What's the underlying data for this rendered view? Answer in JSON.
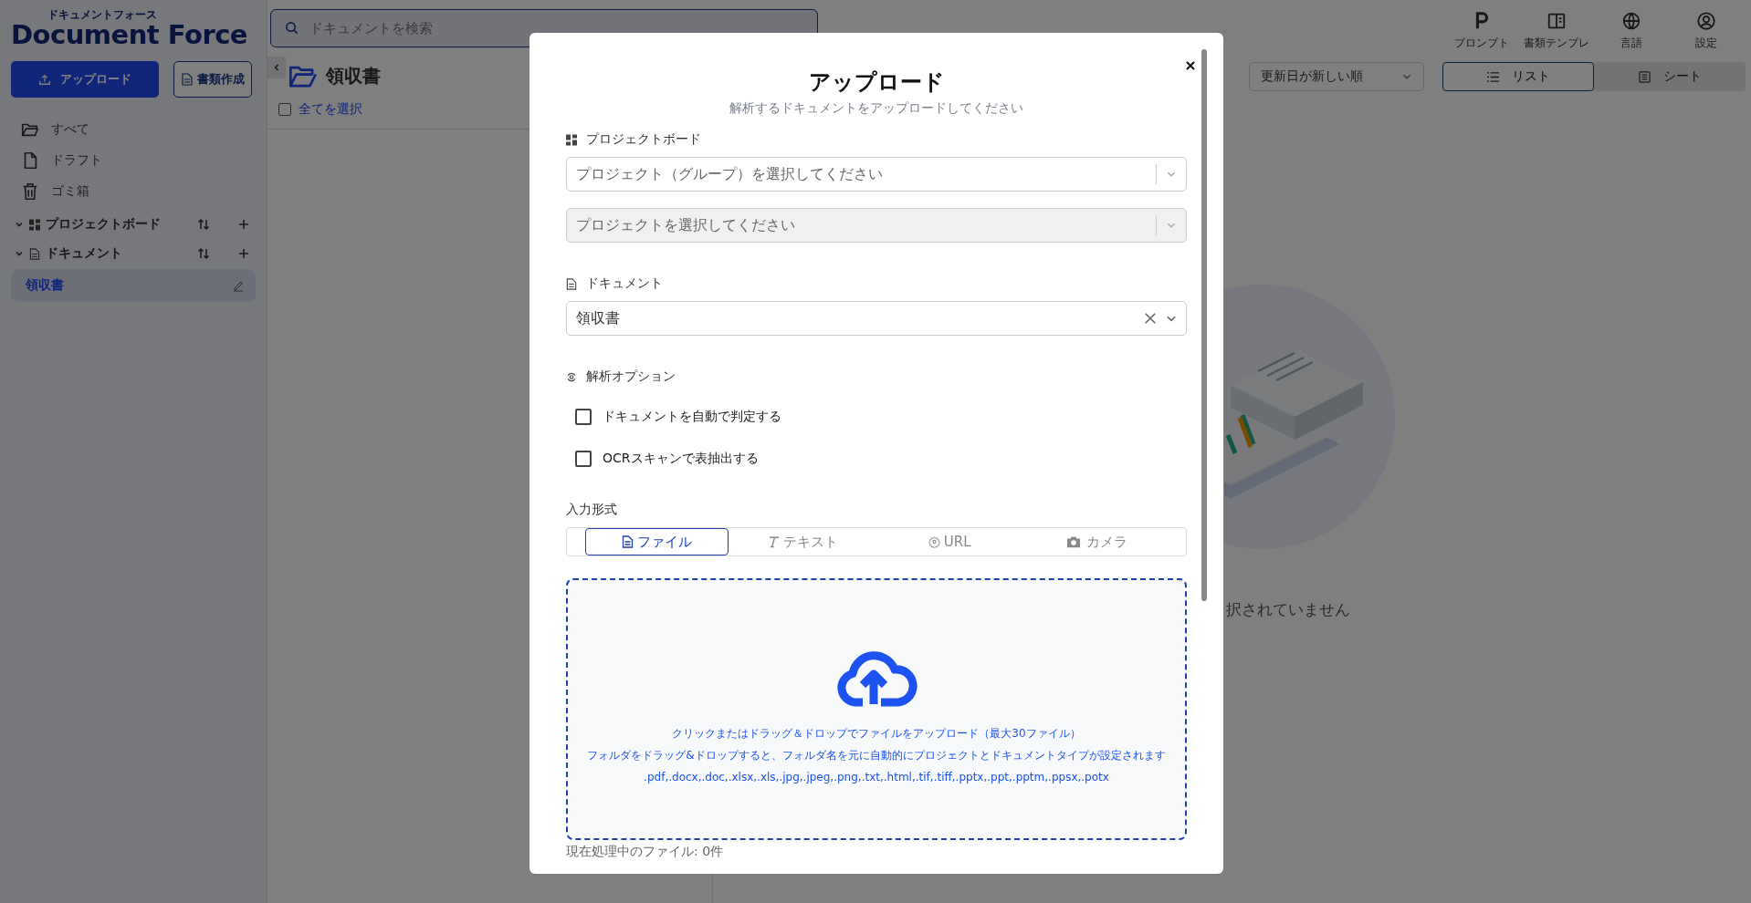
{
  "logo": {
    "kana": "ドキュメントフォース",
    "name": "Document Force"
  },
  "search": {
    "placeholder": "ドキュメントを検索"
  },
  "sidebar": {
    "buttons": [
      {
        "label": "アップロード",
        "kind": "primary"
      },
      {
        "label": "書類作成",
        "kind": "outline"
      }
    ],
    "nav": [
      {
        "label": "すべて",
        "kind": "folder"
      },
      {
        "label": "ドラフト",
        "kind": "file"
      },
      {
        "label": "ゴミ箱",
        "kind": "trash"
      }
    ],
    "sections": [
      {
        "label": "プロジェクトボード",
        "kind": "board",
        "expanded": true
      },
      {
        "label": "ドキュメント",
        "kind": "document",
        "expanded": true,
        "items": [
          {
            "label": "領収書",
            "selected": true
          }
        ]
      }
    ]
  },
  "list_panel": {
    "title": "領収書",
    "select_all": {
      "label": "全てを選択",
      "checked": false
    }
  },
  "toolbar": {
    "icons": [
      {
        "label": "プロンプト",
        "kind": "prompt"
      },
      {
        "label": "書類テンプレ",
        "kind": "template"
      },
      {
        "label": "言語",
        "kind": "language"
      },
      {
        "label": "設定",
        "kind": "settings"
      }
    ],
    "sort": {
      "value": "更新日が新しい順"
    },
    "views": [
      {
        "label": "リスト",
        "kind": "list",
        "selected": true
      },
      {
        "label": "シート",
        "kind": "sheet",
        "selected": false
      }
    ]
  },
  "empty_state": {
    "message": "択されていません"
  },
  "modal": {
    "title": "アップロード",
    "subtitle": "解析するドキュメントをアップロードしてください",
    "project_board": {
      "label": "プロジェクトボード",
      "group_select": {
        "placeholder": "プロジェクト（グループ）を選択してください",
        "disabled": false
      },
      "project_select": {
        "placeholder": "プロジェクトを選択してください",
        "disabled": true
      }
    },
    "document": {
      "label": "ドキュメント",
      "value": "領収書"
    },
    "options": {
      "label": "解析オプション",
      "checkboxes": [
        {
          "label": "ドキュメントを自動で判定する",
          "checked": false
        },
        {
          "label": "OCRスキャンで表抽出する",
          "checked": false
        }
      ]
    },
    "input_format": {
      "label": "入力形式",
      "tabs": [
        {
          "label": "ファイル",
          "kind": "file",
          "selected": true
        },
        {
          "label": "テキスト",
          "kind": "text",
          "selected": false
        },
        {
          "label": "URL",
          "kind": "url",
          "selected": false
        },
        {
          "label": "カメラ",
          "kind": "camera",
          "selected": false
        }
      ]
    },
    "dropzone": {
      "lines": [
        "クリックまたはドラッグ＆ドロップでファイルをアップロード（最大30ファイル）",
        "フォルダをドラッグ&ドロップすると、フォルダ名を元に自動的にプロジェクトとドキュメントタイプが設定されます",
        ".pdf,.docx,.doc,.xlsx,.xls,.jpg,.jpeg,.png,.txt,.html,.tif,.tiff,.pptx,.ppt,.pptm,.ppsx,.potx"
      ]
    },
    "status": "現在処理中のファイル: 0件"
  }
}
